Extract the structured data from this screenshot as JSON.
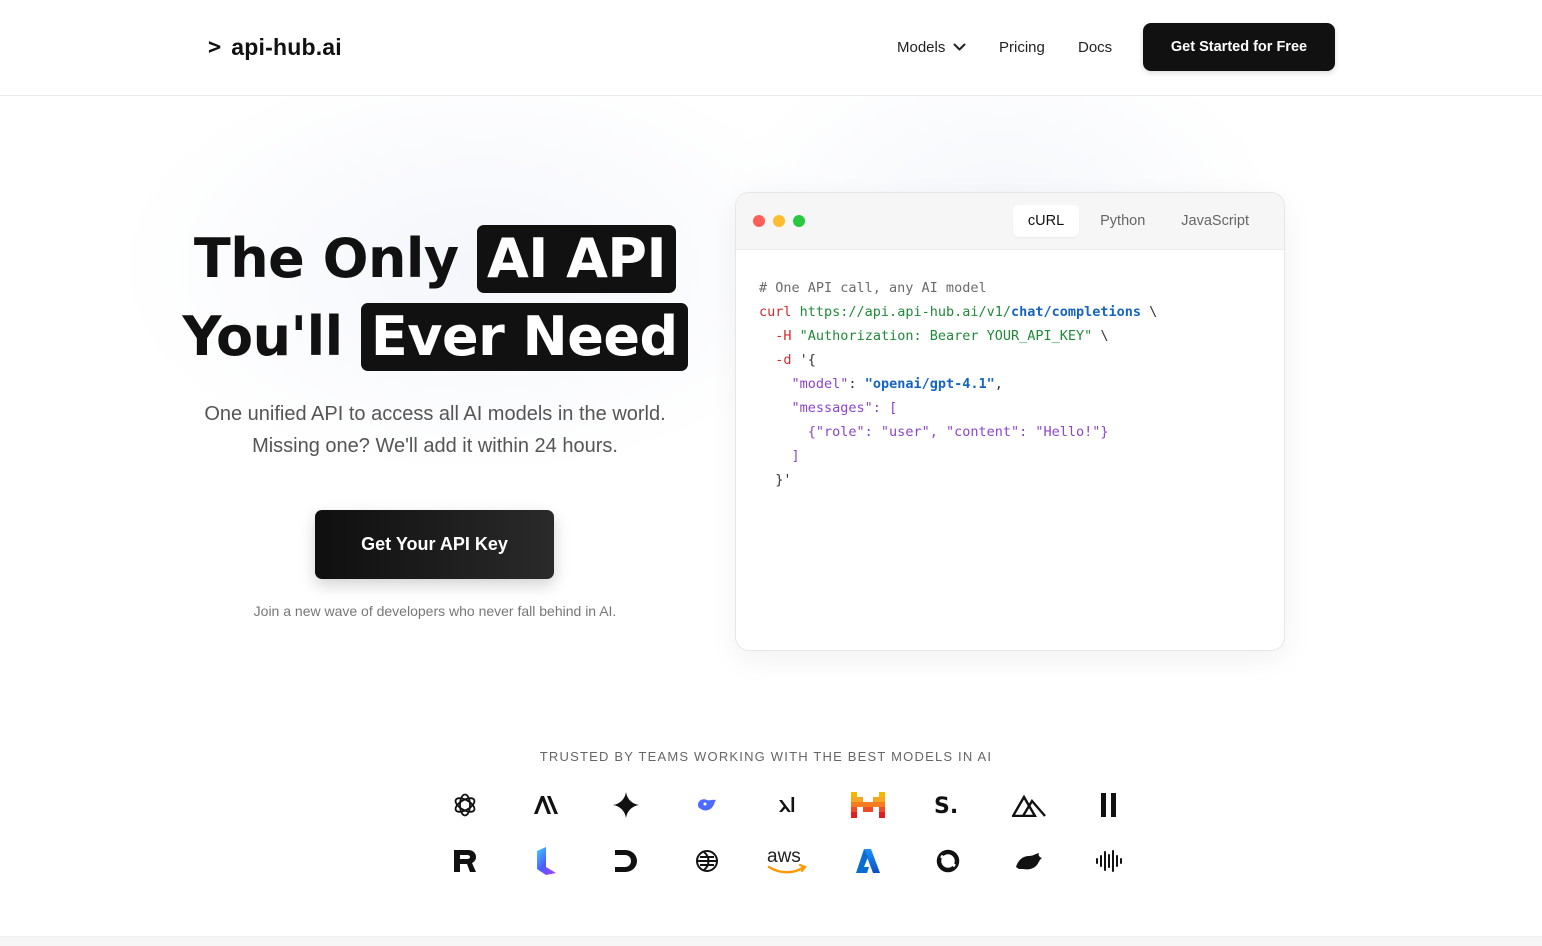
{
  "nav": {
    "logo_mark": ">",
    "logo_text": "api-hub.ai",
    "links": [
      {
        "label": "Models"
      },
      {
        "label": "Pricing"
      },
      {
        "label": "Docs"
      }
    ],
    "cta": "Get Started for Free"
  },
  "hero": {
    "title_line1_plain": "The Only",
    "title_line1_highlight": "AI API",
    "title_line2_plain": "You'll",
    "title_line2_highlight": "Ever Need",
    "subtitle_line1": "One unified API to access all AI models in the world.",
    "subtitle_line2": "Missing one? We'll add it within 24 hours.",
    "cta": "Get Your API Key",
    "note": "Join a new wave of developers who never fall behind in AI."
  },
  "code": {
    "tabs": [
      "cURL",
      "Python",
      "JavaScript"
    ],
    "active_tab": "cURL",
    "comment": "# One API call, any AI model",
    "cmd": "curl",
    "url_base": "https://api.api-hub.ai/v1/",
    "url_path": "chat/completions",
    "line_cont": "\\",
    "flag_h": "-H",
    "header_value": "\"Authorization: Bearer YOUR_API_KEY\"",
    "flag_d": "-d",
    "body_open": "'{",
    "model_key": "\"model\"",
    "model_value": "\"openai/gpt-4.1\"",
    "messages_key": "\"messages\"",
    "messages_open": "[",
    "message_item": "{\"role\": \"user\", \"content\": \"Hello!\"}",
    "messages_close": "]",
    "body_close": "}'"
  },
  "trusted": {
    "heading": "TRUSTED BY TEAMS WORKING WITH THE BEST MODELS IN AI",
    "row1": [
      "openai-icon",
      "anthropic-icon",
      "gemini-icon",
      "deepseek-icon",
      "xai-icon",
      "mistral-icon",
      "stability-icon",
      "perplexity-icon",
      "pause-bars-icon"
    ],
    "row2": [
      "recraft-icon",
      "luma-icon",
      "d-logo-icon",
      "cohere-icon",
      "aws-icon",
      "azure-icon",
      "ring-logo-icon",
      "bird-icon",
      "waveform-icon"
    ],
    "aws_text": "aws"
  },
  "colors": {
    "primary": "#111111",
    "code_comment": "#6b6b6b",
    "code_red": "#d12b2b",
    "code_green": "#1f8a3a",
    "code_blue": "#1565c0",
    "code_purple": "#8e44c9",
    "aws_orange": "#ff9900",
    "azure_blue": "#0a6ed1",
    "mistral_orange": "#f5a623",
    "mistral_red": "#e53935"
  }
}
